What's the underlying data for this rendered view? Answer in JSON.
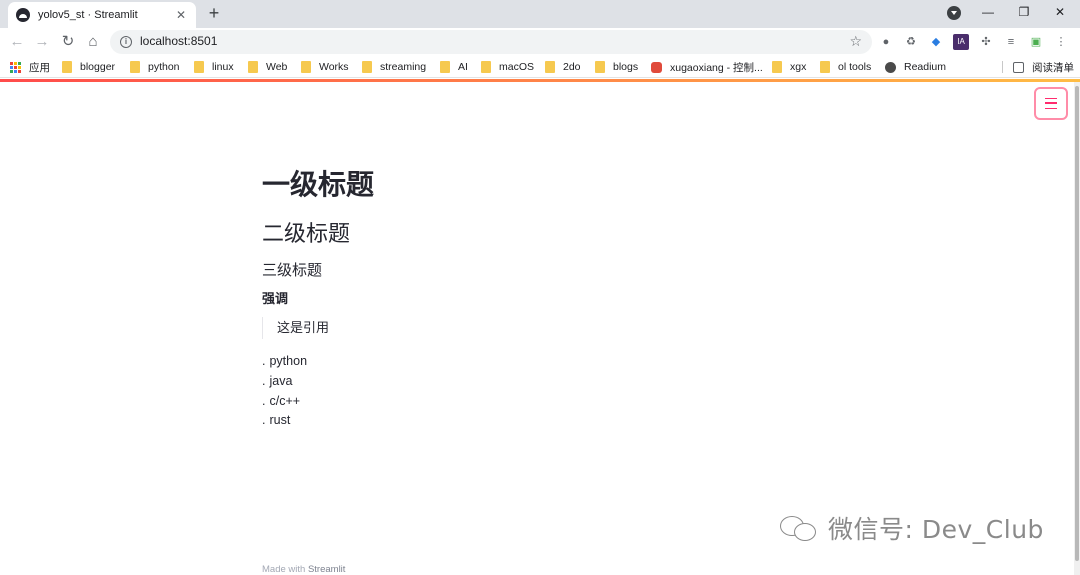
{
  "browser": {
    "tab_title": "yolov5_st · Streamlit",
    "tab_close": "✕",
    "new_tab": "+",
    "window_controls": {
      "minimize": "—",
      "restore": "❐",
      "close": "✕"
    },
    "nav": {
      "back": "←",
      "forward": "→",
      "reload": "↻",
      "home": "⌂"
    },
    "url": "localhost:8501",
    "info_glyph": "i",
    "star_glyph": "☆",
    "extensions": [
      "●",
      "♻",
      "◆",
      "IA",
      "✣",
      "≡",
      "▣",
      "⋮"
    ],
    "bookmarks": [
      {
        "label": "应用",
        "icon": "apps-icon"
      },
      {
        "label": "blogger",
        "icon": "folder-icon"
      },
      {
        "label": "python",
        "icon": "folder-icon"
      },
      {
        "label": "linux",
        "icon": "folder-icon"
      },
      {
        "label": "Web",
        "icon": "folder-icon"
      },
      {
        "label": "Works",
        "icon": "folder-icon"
      },
      {
        "label": "streaming",
        "icon": "folder-icon"
      },
      {
        "label": "AI",
        "icon": "folder-icon"
      },
      {
        "label": "macOS",
        "icon": "folder-icon"
      },
      {
        "label": "2do",
        "icon": "folder-icon"
      },
      {
        "label": "blogs",
        "icon": "folder-icon"
      },
      {
        "label": "xugaoxiang - 控制...",
        "icon": "g-icon"
      },
      {
        "label": "xgx",
        "icon": "folder-icon"
      },
      {
        "label": "ol tools",
        "icon": "folder-icon"
      },
      {
        "label": "Readium",
        "icon": "globe-icon"
      }
    ],
    "reading_list": "阅读清单"
  },
  "app": {
    "h1": "一级标题",
    "h2": "二级标题",
    "h3": "三级标题",
    "strong": "强调",
    "quote": "这是引用",
    "bullet": ".",
    "list": [
      "python",
      "java",
      "c/c++",
      "rust"
    ],
    "footer_prefix": "Made with",
    "footer_brand": "Streamlit"
  },
  "watermark": "微信号: Dev_Club",
  "colors": {
    "accent": "#ff2b6e",
    "menu_border": "#ff8ca8",
    "folder": "#f6c94f",
    "text": "#262730"
  }
}
